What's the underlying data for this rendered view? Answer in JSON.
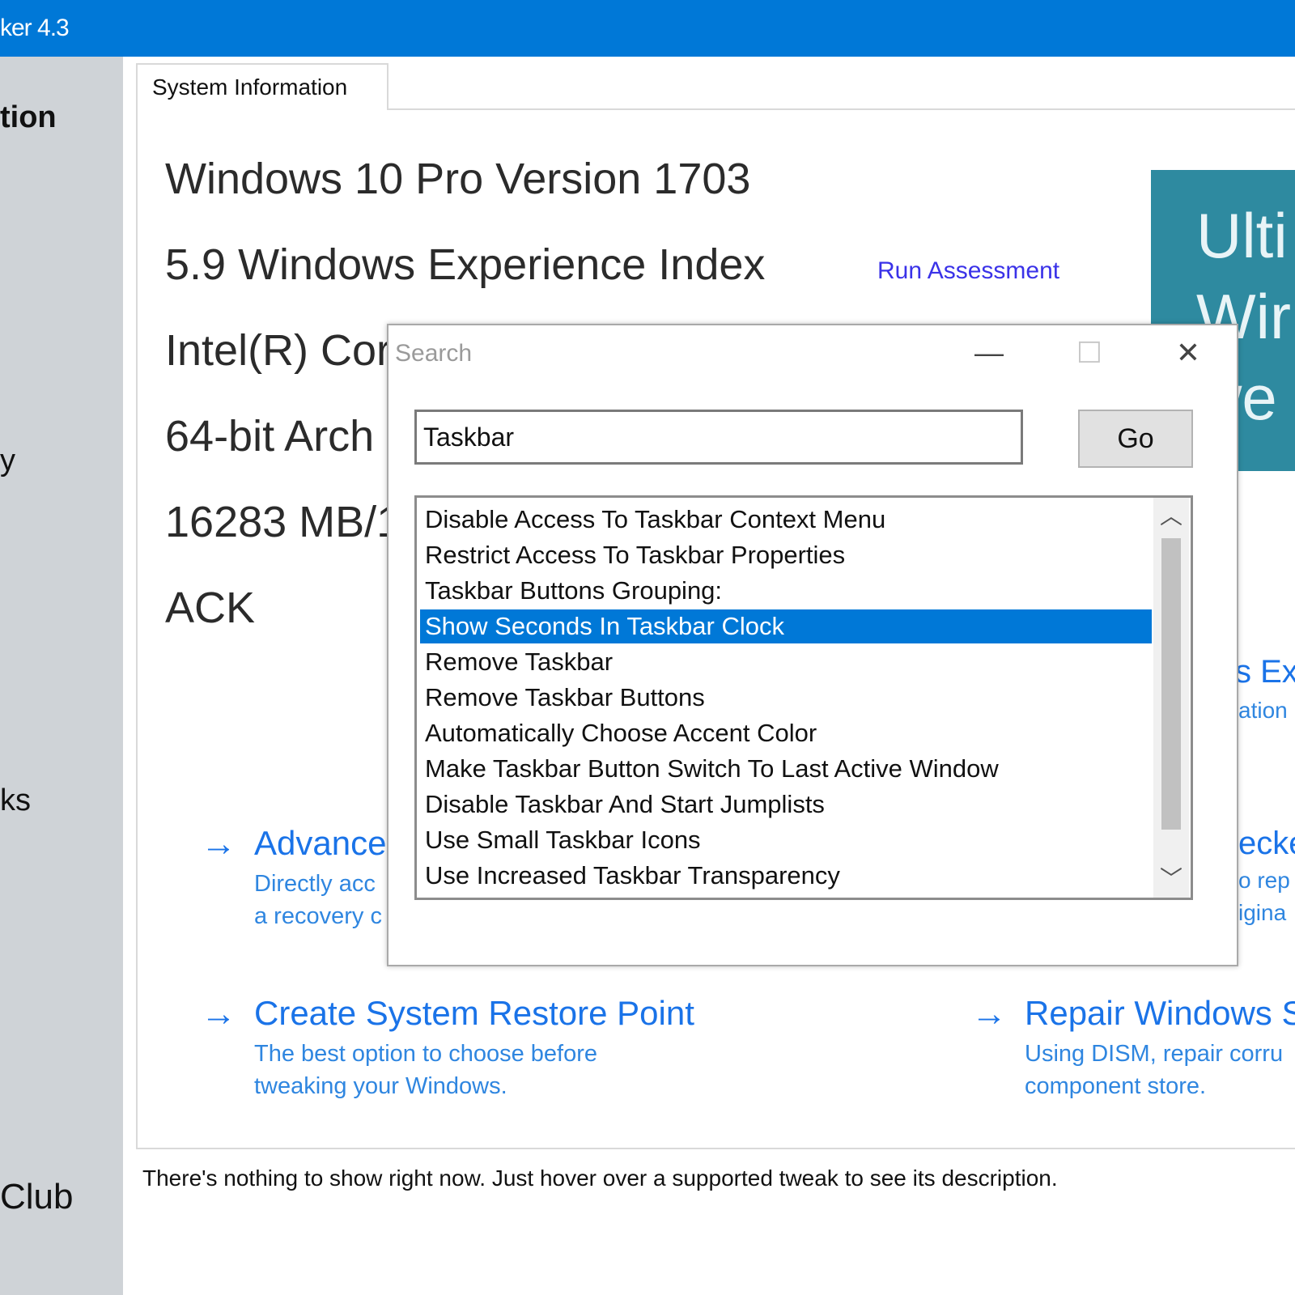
{
  "window": {
    "title": "ker 4.3"
  },
  "sidebar": {
    "items": [
      {
        "label": "tion"
      },
      {
        "label": "y"
      },
      {
        "label": "ks"
      },
      {
        "label": "Club"
      }
    ]
  },
  "tab": {
    "label": "System Information"
  },
  "info": {
    "os": "Windows 10 Pro Version 1703",
    "wei": "5.9 Windows Experience Index",
    "cpu": "Intel(R) Cor",
    "arch": "64-bit Arch",
    "memory": "16283 MB/1",
    "gpu": "ACK",
    "run_assessment": "Run Assessment"
  },
  "promo": {
    "lines": [
      "Ulti",
      "Wir",
      "we"
    ]
  },
  "actions": [
    {
      "title": "Advance",
      "desc1": "Directly acc",
      "desc2": "a recovery c"
    },
    {
      "title": "Create System Restore Point",
      "desc1": "The best option to choose before",
      "desc2": "tweaking your Windows."
    },
    {
      "title": "Repair Windows S",
      "desc1": "Using DISM, repair corru",
      "desc2": "component store."
    }
  ],
  "right_fragments": {
    "exp_title": "s Exp",
    "exp_sub": "ation",
    "check_title": "ecke",
    "check_sub1": "o rep",
    "check_sub2": "igina"
  },
  "status": {
    "text": "There's nothing to show right now. Just hover over a supported tweak to see its description."
  },
  "dialog": {
    "title": "Search",
    "input_value": "Taskbar",
    "go_label": "Go",
    "controls": {
      "minimize": "—",
      "maximize": "☐",
      "close": "✕"
    },
    "results": [
      {
        "label": "Disable Access To Taskbar Context Menu",
        "selected": false
      },
      {
        "label": "Restrict Access To Taskbar Properties",
        "selected": false
      },
      {
        "label": "Taskbar Buttons Grouping:",
        "selected": false
      },
      {
        "label": "Show Seconds In Taskbar Clock",
        "selected": true
      },
      {
        "label": "Remove Taskbar",
        "selected": false
      },
      {
        "label": "Remove Taskbar Buttons",
        "selected": false
      },
      {
        "label": "Automatically Choose Accent Color",
        "selected": false
      },
      {
        "label": "Make Taskbar Button Switch To Last Active Window",
        "selected": false
      },
      {
        "label": "Disable Taskbar And Start Jumplists",
        "selected": false
      },
      {
        "label": "Use Small Taskbar Icons",
        "selected": false
      },
      {
        "label": "Use Increased Taskbar Transparency",
        "selected": false
      }
    ]
  },
  "colors": {
    "accent": "#0078d7",
    "link": "#1a73e8",
    "run_link": "#3a32e8",
    "sidebar": "#cfd3d7",
    "promo": "#2e8aa0"
  }
}
